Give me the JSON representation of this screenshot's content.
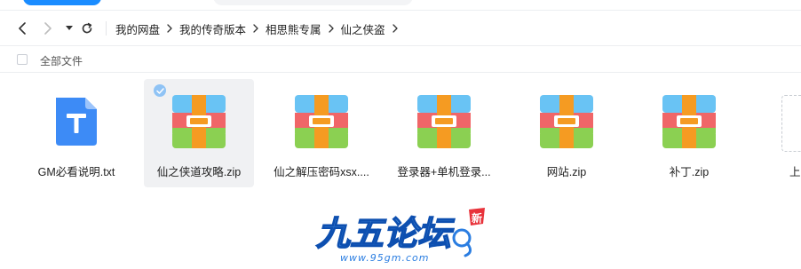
{
  "nav": {
    "breadcrumb": [
      "我的网盘",
      "我的传奇版本",
      "相思熊专属",
      "仙之侠盗"
    ]
  },
  "select_all_label": "全部文件",
  "files": [
    {
      "name": "GM必看说明.txt",
      "icon": "txt-file-icon",
      "selected": false
    },
    {
      "name": "仙之侠道攻略.zip",
      "icon": "zip-archive-icon",
      "selected": true
    },
    {
      "name": "仙之解压密码xsx....",
      "icon": "zip-archive-icon",
      "selected": false
    },
    {
      "name": "登录器+单机登录...",
      "icon": "zip-archive-icon",
      "selected": false
    },
    {
      "name": "网站.zip",
      "icon": "zip-archive-icon",
      "selected": false
    },
    {
      "name": "补丁.zip",
      "icon": "zip-archive-icon",
      "selected": false
    }
  ],
  "partial_item_label": "上",
  "watermark": {
    "title": "九五论坛",
    "url": "www.95gm.com",
    "badge": "新"
  },
  "colors": {
    "accent": "#1a8cff",
    "txt_icon": "#3d8bf6",
    "zip_blue": "#69c3f4",
    "zip_red": "#f06668",
    "zip_green": "#8bd052",
    "zip_orange": "#f59b22"
  }
}
